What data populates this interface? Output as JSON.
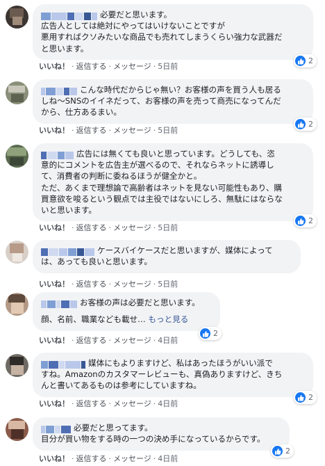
{
  "actions": {
    "like": "いいね！",
    "reply": "返信する",
    "message": "メッセージ",
    "sep": "·"
  },
  "comments": [
    {
      "lines": [
        "必要だと思います。",
        "広告人としては絶対にやってはいけないことですが",
        "悪用すればクソみたいな商品でも売れてしまうくらい強力な武器だ",
        "と思います。"
      ],
      "time": "5日前",
      "reactions": "2"
    },
    {
      "lines": [
        "こんな時代だからじゃ無い？お客様の声を買う人も居る",
        "しね〜SNSのイイネだって、お客様の声を売って商売になってんだ",
        "から、仕方あるまい。"
      ],
      "time": "5日前",
      "reactions": "2"
    },
    {
      "lines": [
        "広告には無くても良いと思っています。どうしても、恣",
        "意的にコメントを広告主が選べるので、それならネットに誘導し",
        "て、消費者の判断に委ねるほうが健全かと。",
        "ただ、あくまで理想論で高齢者はネットを見ない可能性もあり、購",
        "買意欲を唆るという観点では主役ではないにしろ、無駄にはならな",
        "いと思います。"
      ],
      "time": "5日前",
      "reactions": "2"
    },
    {
      "lines": [
        "ケースバイケースだと思いますが、媒体によって",
        "は、あっても良いと思います。"
      ],
      "time": "5日前",
      "reactions": ""
    },
    {
      "lines": [
        "お客様の声は必要だと思います。",
        "",
        "顔、名前、職業なども載せ…"
      ],
      "more": "もっと見る",
      "time": "4日前",
      "reactions": "2"
    },
    {
      "lines": [
        "媒体にもよりますけど、私はあったほうがいい派で",
        "すね。Amazonのカスタマーレビューも、真偽ありますけど、きち",
        "んと書いてあるものは参考にしていますね。"
      ],
      "time": "4日前",
      "reactions": "2"
    },
    {
      "lines": [
        "必要だと思ってます。",
        "目分が買い物をする時の一つの決め手になっているからです。"
      ],
      "time": "4日前",
      "reactions": "2"
    }
  ]
}
